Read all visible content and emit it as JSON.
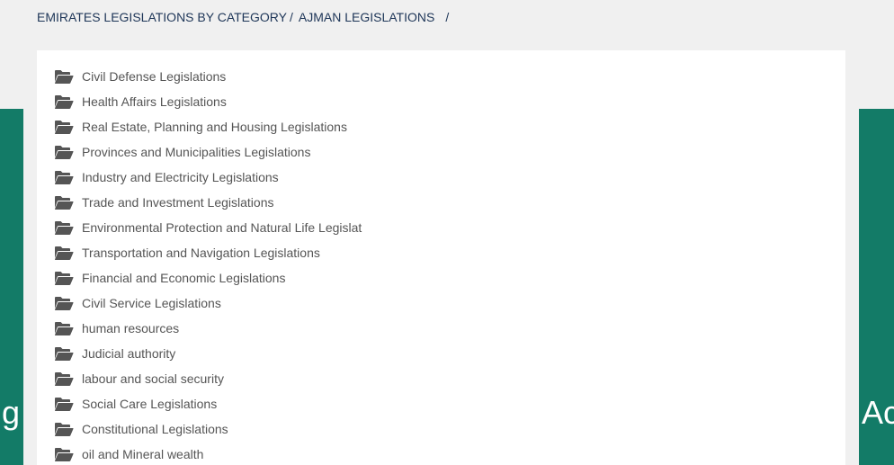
{
  "breadcrumb": {
    "items": [
      {
        "label": "EMIRATES LEGISLATIONS BY CATEGORY"
      },
      {
        "label": "AJMAN LEGISLATIONS"
      }
    ],
    "separator": "/"
  },
  "background": {
    "left_text": "g",
    "right_text": "Ac"
  },
  "colors": {
    "accent_green": "#137b67",
    "breadcrumb_text": "#1d3557",
    "item_text": "#555555",
    "icon": "#555555"
  },
  "folders": [
    {
      "label": "Civil Defense Legislations",
      "icon": "folder-open-icon"
    },
    {
      "label": "Health Affairs Legislations",
      "icon": "folder-open-icon"
    },
    {
      "label": "Real Estate, Planning and Housing Legislations",
      "icon": "folder-open-icon"
    },
    {
      "label": "Provinces and Municipalities Legislations",
      "icon": "folder-open-icon"
    },
    {
      "label": "Industry and Electricity Legislations",
      "icon": "folder-open-icon"
    },
    {
      "label": "Trade and Investment Legislations",
      "icon": "folder-open-icon"
    },
    {
      "label": "Environmental Protection and Natural Life Legislat",
      "icon": "folder-open-icon"
    },
    {
      "label": "Transportation and Navigation Legislations",
      "icon": "folder-open-icon"
    },
    {
      "label": "Financial and Economic Legislations",
      "icon": "folder-open-icon"
    },
    {
      "label": "Civil Service Legislations",
      "icon": "folder-open-icon"
    },
    {
      "label": "human resources",
      "icon": "folder-open-icon"
    },
    {
      "label": "Judicial authority",
      "icon": "folder-open-icon"
    },
    {
      "label": "labour and social security",
      "icon": "folder-open-icon"
    },
    {
      "label": "Social Care Legislations",
      "icon": "folder-open-icon"
    },
    {
      "label": "Constitutional Legislations",
      "icon": "folder-open-icon"
    },
    {
      "label": "oil and Mineral wealth",
      "icon": "folder-open-icon"
    }
  ]
}
